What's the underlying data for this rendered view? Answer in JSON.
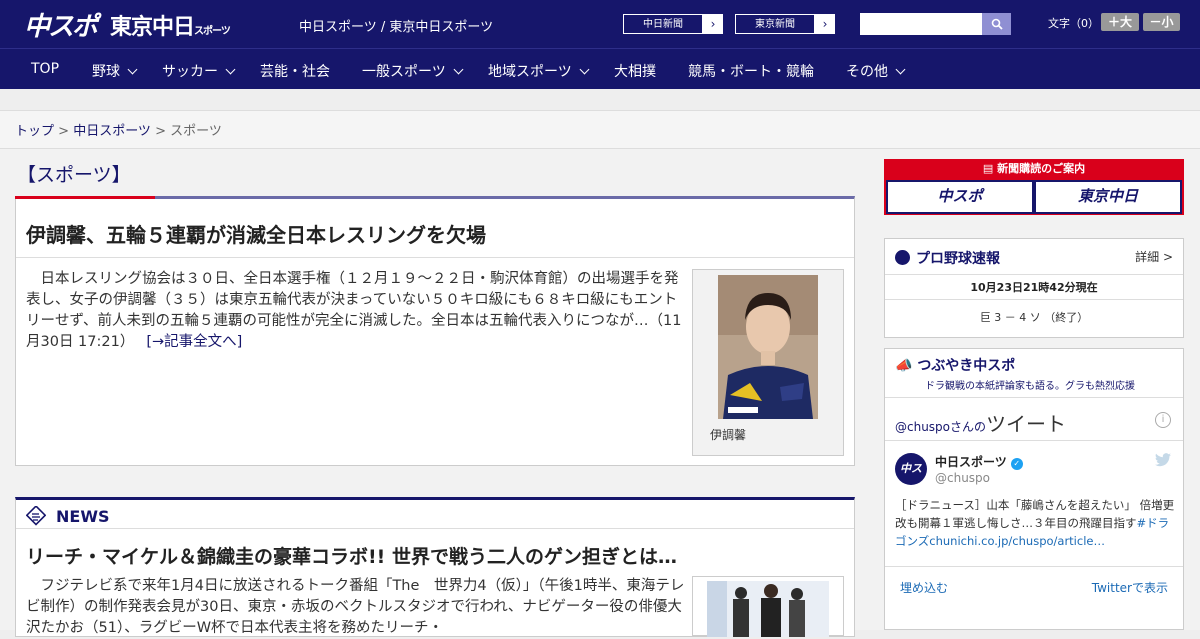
{
  "header": {
    "logo_chuspo": "中スポ",
    "logo_tokyo": "東京中日",
    "logo_tokyo_small": "スポーツ",
    "site_title": "中日スポーツ / 東京中日スポーツ",
    "ext_links": [
      "中日新聞",
      "東京新聞"
    ],
    "search_placeholder": "",
    "font_size_label": "文字（0）",
    "font_larger": "＋大",
    "font_smaller": "－小"
  },
  "nav": {
    "items": [
      {
        "label": "TOP",
        "has_menu": false
      },
      {
        "label": "野球",
        "has_menu": true
      },
      {
        "label": "サッカー",
        "has_menu": true
      },
      {
        "label": "芸能・社会",
        "has_menu": false
      },
      {
        "label": "一般スポーツ",
        "has_menu": true
      },
      {
        "label": "地域スポーツ",
        "has_menu": true
      },
      {
        "label": "大相撲",
        "has_menu": false
      },
      {
        "label": "競馬・ボート・競輪",
        "has_menu": false
      },
      {
        "label": "その他",
        "has_menu": true
      }
    ]
  },
  "breadcrumb": {
    "home": "トップ",
    "sep": " > ",
    "parent": "中日スポーツ",
    "current": "スポーツ"
  },
  "section": {
    "title": "【スポーツ】"
  },
  "featured": {
    "headline": "伊調馨、五輪５連覇が消滅全日本レスリングを欠場",
    "body": "　日本レスリング協会は３０日、全日本選手権（１２月１９～２２日・駒沢体育館）の出場選手を発表し、女子の伊調馨（３５）は東京五輪代表が決まっていない５０キロ級にも６８キロ級にもエントリーせず、前人未到の五輪５連覇の可能性が完全に消滅した。全日本は五輪代表入りにつなが…（11月30日 17:21）",
    "more": "[→記事全文へ]",
    "photo_caption": "伊調馨"
  },
  "news": {
    "label": "NEWS",
    "headline": "リーチ・マイケル＆錦織圭の豪華コラボ!! 世界で戦う二人のゲン担ぎとは…",
    "body": "　フジテレビ系で来年1月4日に放送されるトーク番組「The　世界力4（仮）」（午後1時半、東海テレビ制作）の制作発表会見が30日、東京・赤坂のベクトルスタジオで行われ、ナビゲーター役の俳優大沢たかお（51）、ラグビーW杯で日本代表主将を務めたリーチ・"
  },
  "subscribe": {
    "title": "新聞購読のご案内",
    "logo1": "中スポ",
    "logo2": "東京中日"
  },
  "baseball": {
    "title": "プロ野球速報",
    "detail": "詳細 >",
    "time": "10月23日21時42分現在",
    "score": "巨 3 － 4 ソ （終了）"
  },
  "twitter": {
    "title": "つぶやき中スポ",
    "subtitle": "ドラ観戦の本紙評論家も語る。グラも熱烈応援",
    "handle_prefix": "@chuspo",
    "handle_suffix": "さんの",
    "tweets_label": "ツイート",
    "account_name": "中日スポーツ",
    "account_handle": "@chuspo",
    "avatar_text": "中スポ",
    "tweet_text": "［ドラニュース］山本「藤嶋さんを超えたい」 倍増更改も開幕１軍逃し悔しさ…３年目の飛躍目指す",
    "tweet_link": "#ドラゴンズchunichi.co.jp/chuspo/article…",
    "embed": "埋め込む",
    "view_on": "Twitterで表示"
  },
  "colors": {
    "brand_navy": "#16166b",
    "accent_red": "#d9001b",
    "link_blue": "#1b6ab5"
  }
}
